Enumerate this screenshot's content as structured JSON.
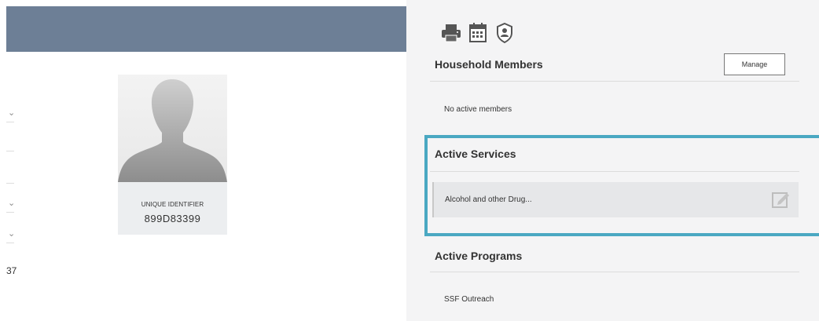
{
  "left": {
    "cut_value": "37",
    "unique_identifier_label": "UNIQUE IDENTIFIER",
    "unique_identifier_value": "899D83399"
  },
  "toolbar": {
    "icons": [
      "printer-icon",
      "calendar-icon",
      "shield-user-icon"
    ]
  },
  "household": {
    "title": "Household Members",
    "manage_label": "Manage",
    "empty_text": "No active members"
  },
  "services": {
    "title": "Active Services",
    "items": [
      {
        "label": "Alcohol and other Drug..."
      }
    ]
  },
  "programs": {
    "title": "Active Programs",
    "items": [
      {
        "label": "SSF Outreach"
      }
    ]
  },
  "colors": {
    "header_bar": "#6d7f96",
    "highlight_border": "#4aa8c2",
    "panel_bg": "#f4f4f5"
  }
}
